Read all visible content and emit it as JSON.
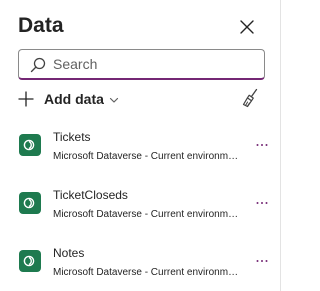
{
  "panel": {
    "title": "Data"
  },
  "search": {
    "placeholder": "Search",
    "value": ""
  },
  "toolbar": {
    "add_data_label": "Add data"
  },
  "colors": {
    "accent": "#742774",
    "dataverse_tile": "#1e7a4f"
  },
  "icons": {
    "close": "close-icon",
    "search": "search-icon",
    "add": "plus-icon",
    "dropdown": "chevron-down-icon",
    "clear": "broom-icon",
    "datasource": "dataverse-icon",
    "more": "more-icon"
  },
  "data_sources": [
    {
      "name": "Tickets",
      "description": "Microsoft Dataverse - Current environment"
    },
    {
      "name": "TicketCloseds",
      "description": "Microsoft Dataverse - Current environment"
    },
    {
      "name": "Notes",
      "description": "Microsoft Dataverse - Current environment"
    }
  ]
}
